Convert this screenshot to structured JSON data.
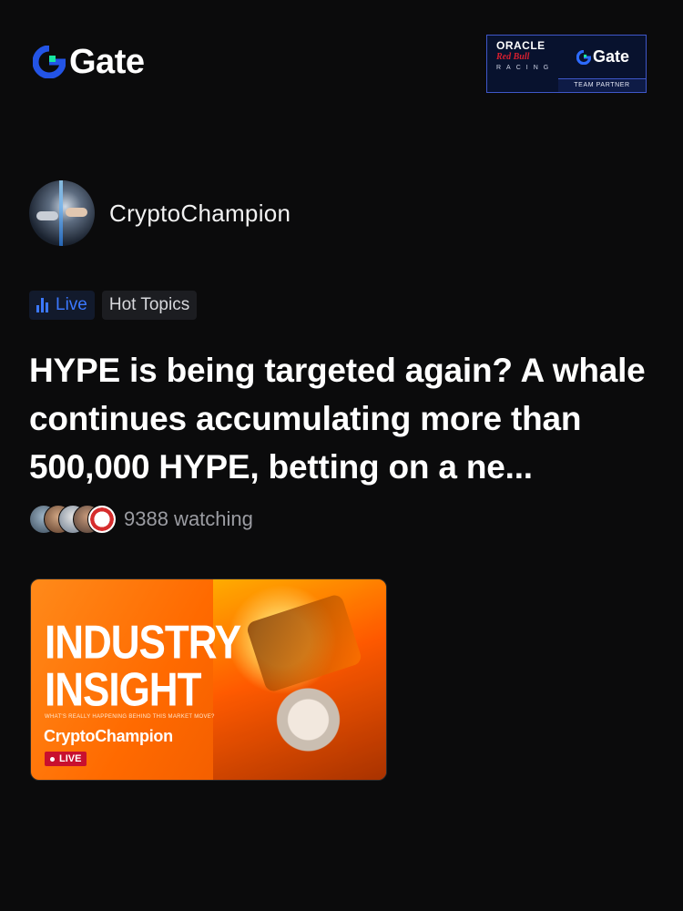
{
  "header": {
    "logo_text": "Gate",
    "partner": {
      "oracle": "ORACLE",
      "redbull": "Red Bull",
      "racing": "RACING",
      "gate": "Gate",
      "team_partner": "TEAM PARTNER"
    }
  },
  "author": {
    "name": "CryptoChampion"
  },
  "tags": {
    "live": "Live",
    "hot_topics": "Hot Topics"
  },
  "post": {
    "headline": "HYPE is being targeted again? A whale continues accumulating more than 500,000 HYPE, betting on a ne...",
    "watching": "9388 watching"
  },
  "thumbnail": {
    "title_line1": "INDUSTRY",
    "title_line2": "INSIGHT",
    "subtitle": "WHAT'S REALLY HAPPENING BEHIND THIS MARKET MOVE?",
    "name": "CryptoChampion",
    "live_badge": "LIVE"
  },
  "colors": {
    "accent_blue": "#3b78ff",
    "gate_green": "#17e6a1",
    "gate_blue": "#2354e6",
    "live_red": "#c8102e",
    "thumb_orange": "#ff6a00"
  },
  "icons": [
    "gate-logo-icon",
    "live-bars-icon",
    "viewer-avatar-icon"
  ]
}
